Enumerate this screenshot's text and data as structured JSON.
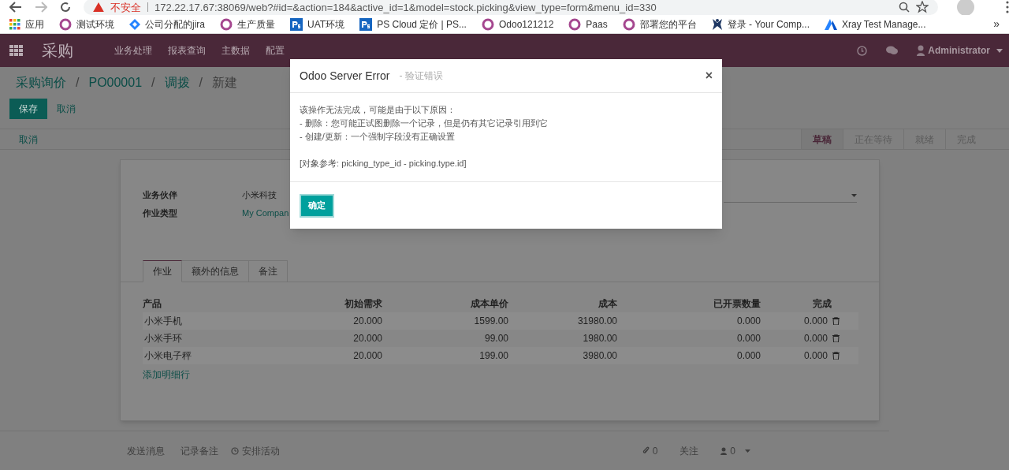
{
  "browser": {
    "security_label": "不安全",
    "url": "172.22.17.67:38069/web?#id=&action=184&active_id=1&model=stock.picking&view_type=form&menu_id=330",
    "bookmarks": [
      {
        "kind": "apps",
        "label": "应用"
      },
      {
        "kind": "circle",
        "label": "测试环境"
      },
      {
        "kind": "diamond",
        "label": "公司分配的jira"
      },
      {
        "kind": "circle",
        "label": "生产质量"
      },
      {
        "kind": "ps",
        "label": "UAT环境"
      },
      {
        "kind": "ps",
        "label": "PS Cloud 定价 | PS..."
      },
      {
        "kind": "circle",
        "label": "Odoo121212"
      },
      {
        "kind": "circle",
        "label": "Paas"
      },
      {
        "kind": "circle",
        "label": "部署您的平台"
      },
      {
        "kind": "figure",
        "label": "登录 - Your Comp..."
      },
      {
        "kind": "triangle",
        "label": "Xray Test Manage..."
      }
    ],
    "more": "»"
  },
  "navbar": {
    "app": "采购",
    "menus": [
      "业务处理",
      "报表查询",
      "主数据",
      "配置"
    ],
    "user": "Administrator"
  },
  "breadcrumb": [
    {
      "label": "采购询价",
      "link": true
    },
    {
      "separator": "/",
      "label": "PO00001",
      "link": true
    },
    {
      "separator": "/",
      "label": "调拨",
      "link": true
    },
    {
      "separator": "/",
      "label": "新建",
      "link": false
    }
  ],
  "actions": {
    "save": "保存",
    "discard": "取消"
  },
  "header": {
    "cancel": "取消",
    "stages": [
      {
        "label": "草稿",
        "selected": true
      },
      {
        "label": "正在等待",
        "selected": false
      },
      {
        "label": "就绪",
        "selected": false
      },
      {
        "label": "完成",
        "selected": false
      }
    ]
  },
  "form": {
    "fields": [
      {
        "label": "业务伙伴",
        "value": "小米科技",
        "link": false
      },
      {
        "label": "作业类型",
        "value": "My Compan",
        "link": true
      }
    ],
    "tabs": [
      {
        "label": "作业",
        "selected": true
      },
      {
        "label": "额外的信息",
        "selected": false
      },
      {
        "label": "备注",
        "selected": false
      }
    ],
    "table": {
      "columns": [
        "产品",
        "初始需求",
        "成本单价",
        "成本",
        "已开票数量",
        "完成"
      ],
      "rows": [
        [
          "小米手机",
          "20.000",
          "1599.00",
          "31980.00",
          "0.000",
          "0.000"
        ],
        [
          "小米手环",
          "20.000",
          "99.00",
          "1980.00",
          "0.000",
          "0.000"
        ],
        [
          "小米电子秤",
          "20.000",
          "199.00",
          "3980.00",
          "0.000",
          "0.000"
        ]
      ],
      "add_line": "添加明细行"
    }
  },
  "chatter": {
    "send": "发送消息",
    "note": "记录备注",
    "activity": "安排活动",
    "attachments": "0",
    "follow": "关注",
    "followers": "0"
  },
  "dialog": {
    "title": "Odoo Server Error",
    "subtitle": "- 验证错误",
    "close": "×",
    "lines": [
      "该操作无法完成，可能是由于以下原因：",
      "- 删除：您可能正试图删除一个记录，但是仍有其它记录引用到它",
      "- 创建/更新：一个强制字段没有正确设置"
    ],
    "reference": "[对象参考: picking_type_id - picking.type.id]",
    "ok": "确定"
  }
}
